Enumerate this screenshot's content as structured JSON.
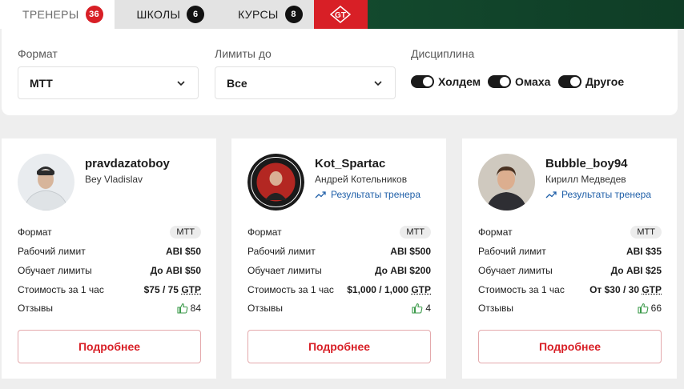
{
  "tabs": [
    {
      "label": "ТРЕНЕРЫ",
      "count": "36"
    },
    {
      "label": "ШКОЛЫ",
      "count": "6"
    },
    {
      "label": "КУРСЫ",
      "count": "8"
    }
  ],
  "brand": {
    "logo_text": "GT",
    "accent": "#d81f26",
    "dark_green": "#0d3a22"
  },
  "filters": {
    "format_label": "Формат",
    "format_value": "МТТ",
    "limits_label": "Лимиты до",
    "limits_value": "Все",
    "discipline_label": "Дисциплина",
    "disciplines": [
      "Холдем",
      "Омаха",
      "Другое"
    ]
  },
  "row_labels": {
    "format": "Формат",
    "work_limit": "Рабочий лимит",
    "teaches": "Обучает лимиты",
    "price": "Стоимость за 1 час",
    "reviews": "Отзывы"
  },
  "more_label": "Подробнее",
  "cards": [
    {
      "name": "pravdazatoboy",
      "realname": "Bey Vladislav",
      "results": "",
      "format": "MTT",
      "work_limit": "ABI $50",
      "teaches": "До ABI $50",
      "price_main": "$75 / 75 ",
      "price_unit": "GTP",
      "reviews": "84"
    },
    {
      "name": "Kot_Spartac",
      "realname": "Андрей Котельников",
      "results": "Результаты тренера",
      "format": "MTT",
      "work_limit": "ABI $500",
      "teaches": "До ABI $200",
      "price_main": "$1,000 / 1,000 ",
      "price_unit": "GTP",
      "reviews": "4"
    },
    {
      "name": "Bubble_boy94",
      "realname": "Кирилл Медведев",
      "results": "Результаты тренера",
      "format": "MTT",
      "work_limit": "ABI $35",
      "teaches": "До ABI $25",
      "price_main": "От $30 / 30 ",
      "price_unit": "GTP",
      "reviews": "66"
    }
  ]
}
